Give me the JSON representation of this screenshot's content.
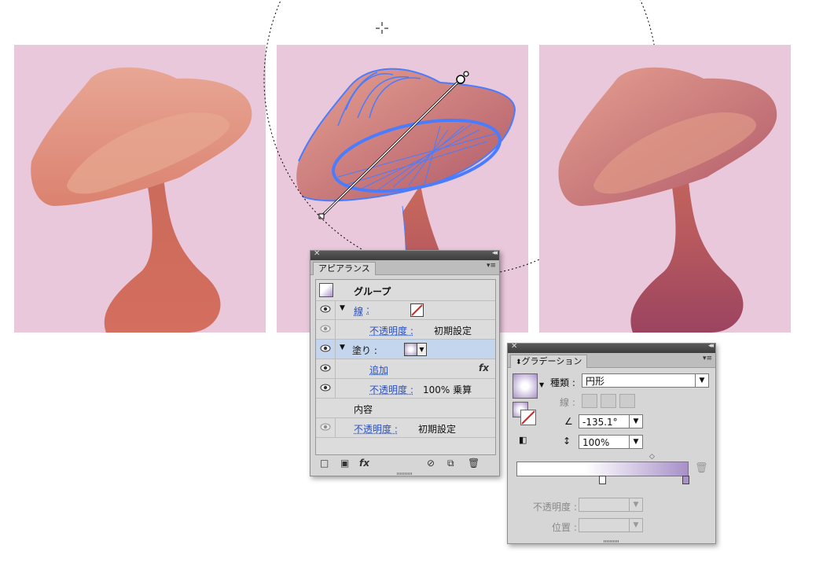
{
  "appearance_panel": {
    "tab": "アピアランス",
    "group_label": "グループ",
    "rows": {
      "stroke_label": "線",
      "stroke_colon": ":",
      "stroke_opacity_label": "不透明度 :",
      "stroke_opacity_value": "初期設定",
      "fill_label": "塗り :",
      "add_label": "追加",
      "fill_opacity_label": "不透明度 :",
      "fill_opacity_value": "100% 乗算",
      "content_label": "内容",
      "opacity_label": "不透明度 :",
      "opacity_value": "初期設定"
    },
    "fx_glyph": "fx",
    "footer_fx": "fx"
  },
  "gradient_panel": {
    "tab": "グラデーション",
    "type_label": "種類 :",
    "type_value": "円形",
    "stroke_label": "線 :",
    "angle_value": "-135.1°",
    "aspect_value": "100%",
    "opacity_label": "不透明度 :",
    "position_label": "位置 :",
    "colors": {
      "start": "#ffffff",
      "end": "#a890c8"
    }
  },
  "canvas": {
    "background_color": "#eac8dc",
    "mushroom_colors": {
      "cap": "#e2907e",
      "stem": "#d57264",
      "shaded_stem": "#a54a62"
    },
    "selection_color": "#4a7cff"
  }
}
